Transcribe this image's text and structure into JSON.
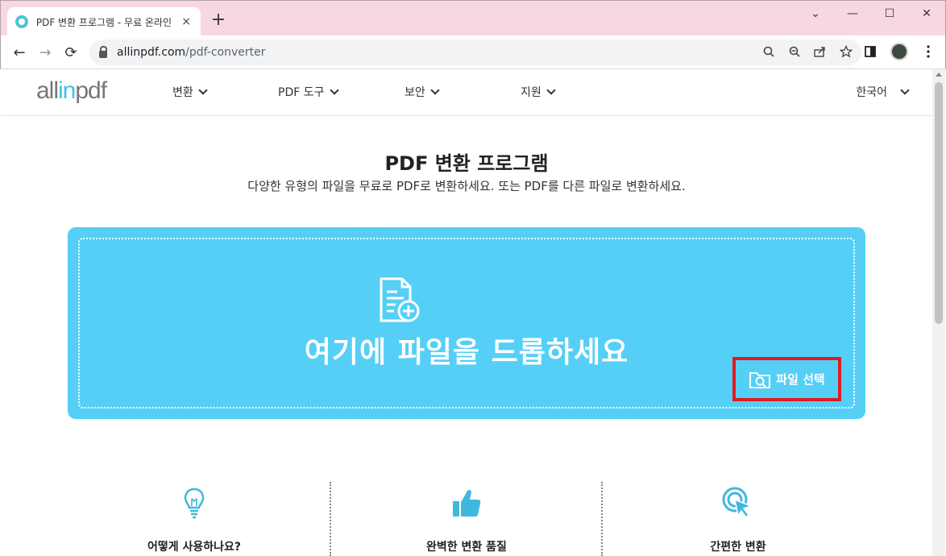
{
  "browser": {
    "tab_title": "PDF 변환 프로그램 - 무료 온라인",
    "tab_close": "×",
    "new_tab": "+",
    "url_host": "allinpdf.com",
    "url_path": "/pdf-converter",
    "window": {
      "minimize": "—",
      "maximize": "☐",
      "close": "✕",
      "collapse": "⌄"
    },
    "nav": {
      "back": "←",
      "forward": "→",
      "reload": "⟳"
    }
  },
  "site": {
    "logo_prefix": "all",
    "logo_in": "in",
    "logo_suffix": "pdf",
    "menu": [
      {
        "label": "변환"
      },
      {
        "label": "PDF 도구"
      },
      {
        "label": "보안"
      },
      {
        "label": "지원"
      }
    ],
    "language": "한국어"
  },
  "hero": {
    "title": "PDF 변환 프로그램",
    "subtitle": "다양한 유형의 파일을 무료로 PDF로 변환하세요. 또는 PDF를 다른 파일로 변환하세요."
  },
  "dropzone": {
    "text": "여기에 파일을 드롭하세요",
    "choose_file": "파일 선택"
  },
  "features": [
    {
      "label": "어떻게 사용하나요?",
      "icon": "lightbulb-icon"
    },
    {
      "label": "완벽한 변환 품질",
      "icon": "thumbs-up-icon"
    },
    {
      "label": "간편한 변환",
      "icon": "click-target-icon"
    }
  ],
  "colors": {
    "accent": "#55cff6",
    "highlight_border": "#e01b22",
    "titlebar": "#f8d7e4",
    "icon_blue": "#3fb8e0"
  }
}
